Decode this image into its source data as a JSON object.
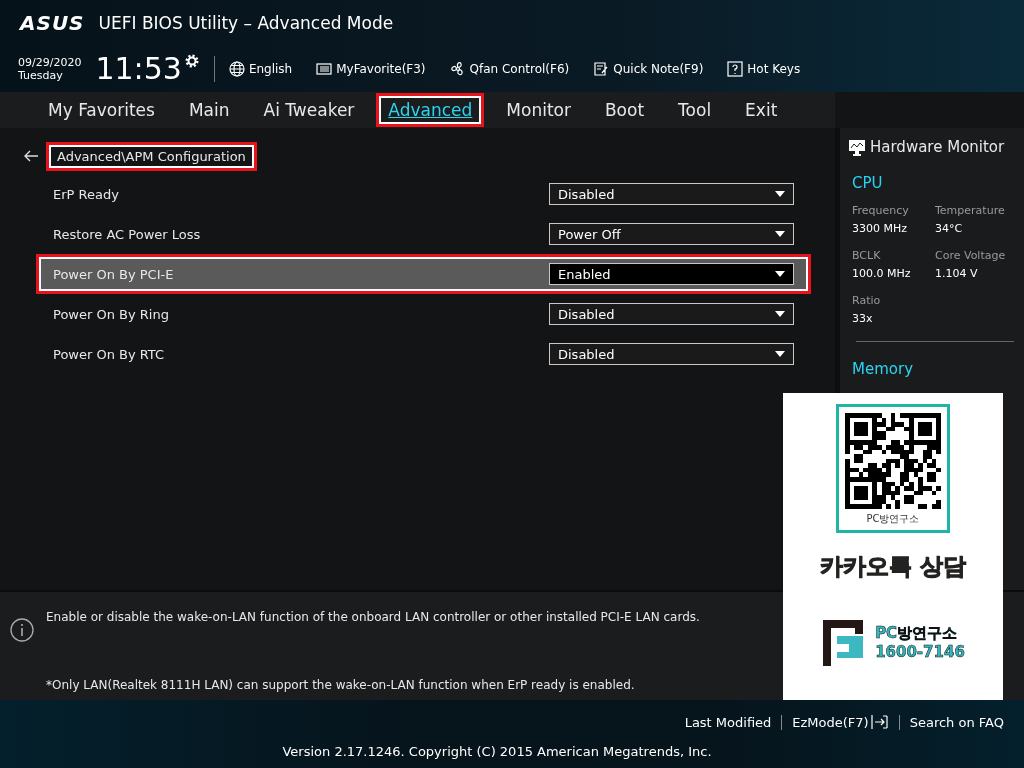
{
  "window": {
    "brand": "ASUS",
    "title": "UEFI BIOS Utility – Advanced Mode"
  },
  "info_bar": {
    "date": "09/29/2020",
    "day": "Tuesday",
    "time": "11:53",
    "tools": [
      {
        "kind": "globe",
        "label": "English"
      },
      {
        "kind": "list",
        "label": "MyFavorite(F3)"
      },
      {
        "kind": "fan",
        "label": "Qfan Control(F6)"
      },
      {
        "kind": "note",
        "label": "Quick Note(F9)"
      },
      {
        "kind": "help",
        "label": "Hot Keys"
      }
    ]
  },
  "tabs": [
    {
      "label": "My Favorites",
      "selected": false,
      "highlighted": false
    },
    {
      "label": "Main",
      "selected": false,
      "highlighted": false
    },
    {
      "label": "Ai Tweaker",
      "selected": false,
      "highlighted": false
    },
    {
      "label": "Advanced",
      "selected": true,
      "highlighted": true
    },
    {
      "label": "Monitor",
      "selected": false,
      "highlighted": false
    },
    {
      "label": "Boot",
      "selected": false,
      "highlighted": false
    },
    {
      "label": "Tool",
      "selected": false,
      "highlighted": false
    },
    {
      "label": "Exit",
      "selected": false,
      "highlighted": false
    }
  ],
  "breadcrumb": {
    "path": "Advanced\\APM Configuration",
    "highlighted": true
  },
  "settings": [
    {
      "label": "ErP Ready",
      "value": "Disabled",
      "selected": false,
      "highlighted": false
    },
    {
      "label": "Restore AC Power Loss",
      "value": "Power Off",
      "selected": false,
      "highlighted": false
    },
    {
      "label": "Power On By PCI-E",
      "value": "Enabled",
      "selected": true,
      "highlighted": true
    },
    {
      "label": "Power On By Ring",
      "value": "Disabled",
      "selected": false,
      "highlighted": false
    },
    {
      "label": "Power On By RTC",
      "value": "Disabled",
      "selected": false,
      "highlighted": false
    }
  ],
  "hardware_monitor": {
    "title": "Hardware Monitor",
    "sections": [
      {
        "title": "CPU",
        "items": [
          {
            "label": "Frequency",
            "value": "3300 MHz"
          },
          {
            "label": "Temperature",
            "value": "34°C"
          },
          {
            "label": "BCLK",
            "value": "100.0 MHz"
          },
          {
            "label": "Core Voltage",
            "value": "1.104 V"
          },
          {
            "label": "Ratio",
            "value": "33x"
          }
        ]
      },
      {
        "title": "Memory"
      }
    ]
  },
  "help": {
    "description": "Enable or disable the wake-on-LAN function of the onboard LAN controller or other installed PCI-E LAN cards.",
    "note": "*Only LAN(Realtek 8111H LAN) can support the wake-on-LAN function when ErP ready is enabled."
  },
  "footer": {
    "links": [
      {
        "label": "Last Modified",
        "icon": false
      },
      {
        "label": "EzMode(F7)",
        "icon": true
      },
      {
        "label": "Search on FAQ",
        "icon": false
      }
    ],
    "version": "Version 2.17.1246. Copyright (C) 2015 American Megatrends, Inc."
  },
  "promo": {
    "qr_caption": "PC방연구소",
    "headline": "카카오톡 상담",
    "brand": "PC방연구소",
    "phone": "1600-7146"
  }
}
